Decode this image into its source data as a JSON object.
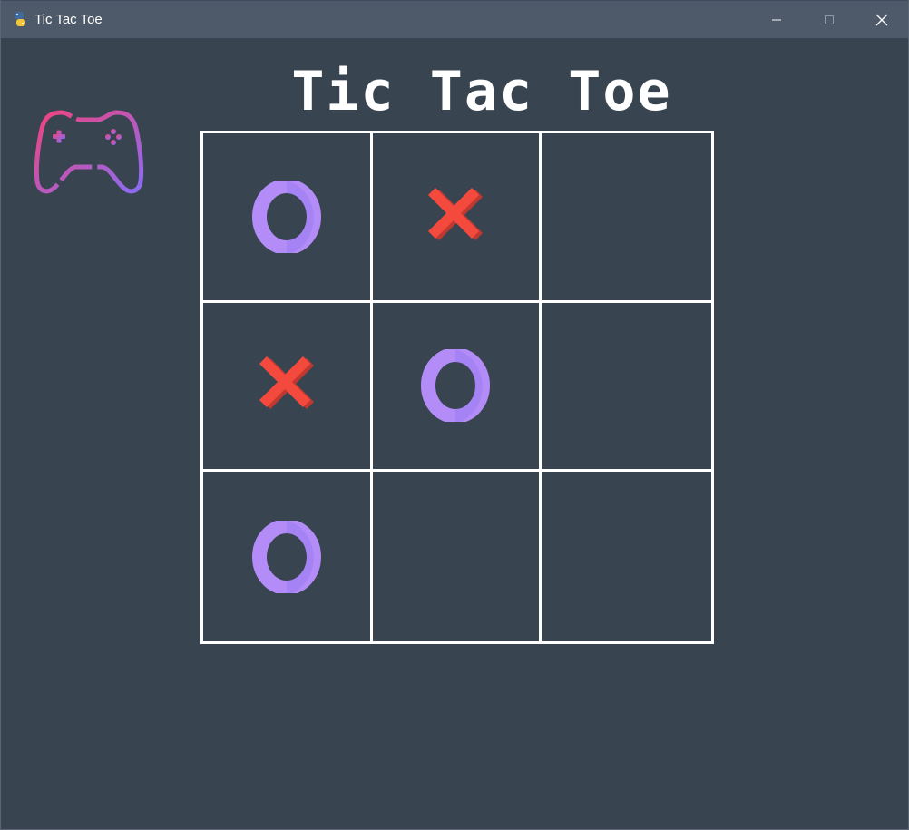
{
  "window": {
    "title": "Tic Tac Toe",
    "controls": [
      "minimize",
      "maximize",
      "close"
    ]
  },
  "game": {
    "title": "Tic Tac Toe",
    "logo_icon": "gamepad-icon",
    "board": [
      [
        "O",
        "X",
        ""
      ],
      [
        "X",
        "O",
        ""
      ],
      [
        "O",
        "",
        ""
      ]
    ]
  },
  "colors": {
    "background": "#384450",
    "titlebar": "#4e5a69",
    "grid_lines": "#ffffff",
    "x_mark": "#f44a3e",
    "o_mark": "#b48cf7",
    "controller_gradient_start": "#f0437d",
    "controller_gradient_end": "#8a6cf2"
  }
}
